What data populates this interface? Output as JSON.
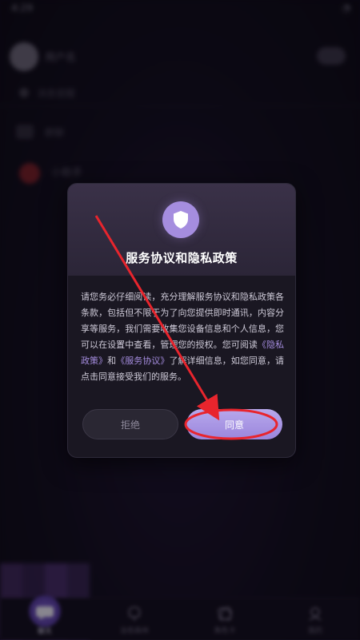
{
  "status_bar": {
    "time": "4:29",
    "icons": "◔"
  },
  "background": {
    "username": "用户名",
    "row1": "消息提醒",
    "row2": "群聊",
    "row3": "小助手"
  },
  "dialog": {
    "title": "服务协议和隐私政策",
    "body_part1": "请您务必仔细阅读，充分理解服务协议和隐私政策各条款，包括但不限于为了向您提供即时通讯，内容分享等服务，我们需要收集您设备信息和个人信息，您可以在设置中查看，管理您的授权。您可阅读",
    "privacy_link": "《隐私政策》",
    "and": "和",
    "service_link": "《服务协议》",
    "body_part2": "了解详细信息，如您同意，请点击同意接受我们的服务。",
    "decline_label": "拒绝",
    "agree_label": "同意",
    "icon": "shield-icon"
  },
  "bottom_nav": {
    "items": [
      {
        "label": "聊天",
        "icon": "chat-icon",
        "active": true
      },
      {
        "label": "治愈森林",
        "icon": "forest-icon",
        "active": false
      },
      {
        "label": "角色卡",
        "icon": "card-icon",
        "active": false
      },
      {
        "label": "我的",
        "icon": "profile-icon",
        "active": false
      }
    ]
  },
  "colors": {
    "accent": "#a58ddf",
    "annotation": "#e8252d",
    "dialog_bg": "#1a1722"
  }
}
